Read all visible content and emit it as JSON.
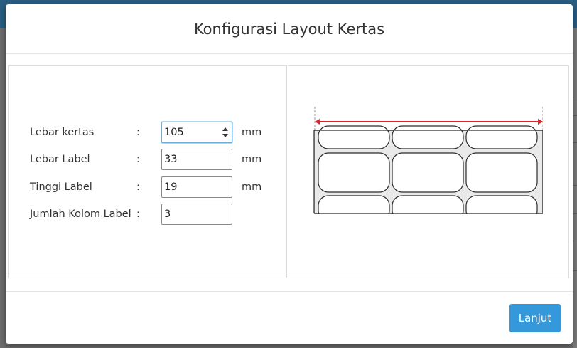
{
  "modal": {
    "title": "Konfigurasi Layout Kertas"
  },
  "form": {
    "fields": [
      {
        "label": "Lebar kertas",
        "colon": ":",
        "value": "105",
        "unit": "mm"
      },
      {
        "label": "Lebar Label",
        "colon": ":",
        "value": "33",
        "unit": "mm"
      },
      {
        "label": "Tinggi Label",
        "colon": ":",
        "value": "19",
        "unit": "mm"
      },
      {
        "label": "Jumlah Kolom Label",
        "colon": ":",
        "value": "3",
        "unit": ""
      }
    ]
  },
  "footer": {
    "next_label": "Lanjut"
  },
  "colors": {
    "accent": "#3498db",
    "width_indicator": "#d9262e"
  }
}
